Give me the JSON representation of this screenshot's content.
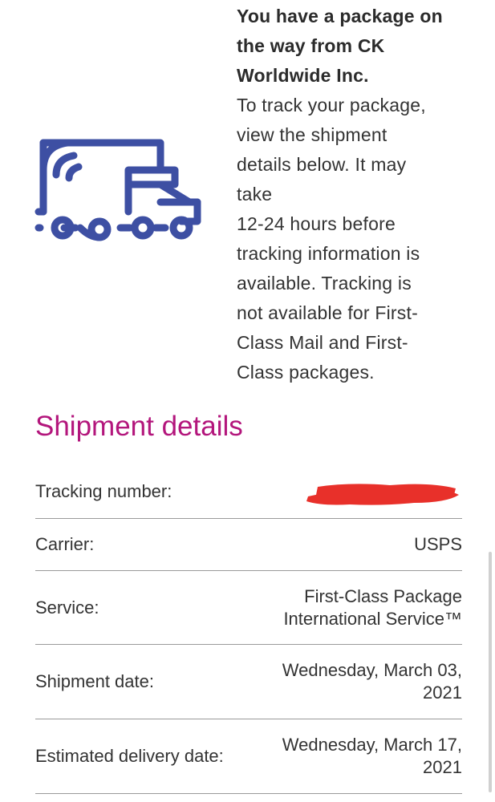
{
  "intro": {
    "headline_lines": [
      "You have a package on",
      "the way from CK",
      "Worldwide Inc."
    ],
    "body_lines": [
      "To track your package,",
      "view the shipment",
      "details below. It may",
      "take",
      "12-24 hours before",
      "tracking information is",
      "available. Tracking is",
      "not available for First-",
      "Class Mail and First-",
      "Class packages."
    ]
  },
  "icon": "delivery-truck-icon",
  "colors": {
    "icon": "#3d4fa3",
    "title": "#b3167c",
    "redaction": "#e8302a",
    "divider": "#9a9a9a"
  },
  "section_title": "Shipment details",
  "details": [
    {
      "label": "Tracking number:",
      "value_lines": []
    },
    {
      "label": "Carrier:",
      "value_lines": [
        "USPS"
      ]
    },
    {
      "label": "Service:",
      "value_lines": [
        "First-Class Package",
        "International Service™"
      ]
    },
    {
      "label": "Shipment date:",
      "value_lines": [
        "Wednesday, March 03,",
        "2021"
      ]
    },
    {
      "label": "Estimated delivery date:",
      "value_lines": [
        "Wednesday, March 17,",
        "2021"
      ]
    }
  ]
}
